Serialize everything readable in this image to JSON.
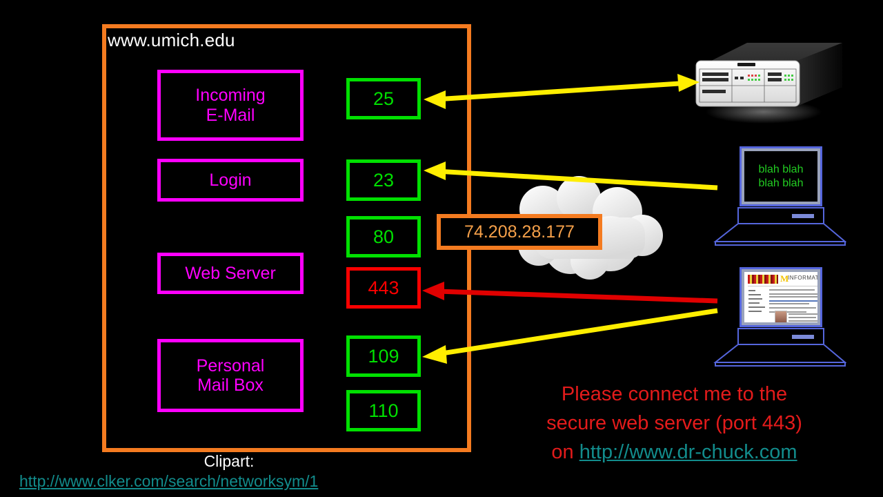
{
  "slide": {
    "background_color": "#000000",
    "domain_label": "www.umich.edu",
    "boundary_color": "#f47b20"
  },
  "services": [
    {
      "name": "incoming-email",
      "lines": [
        "Incoming",
        "E-Mail"
      ],
      "color": "#ff00ff"
    },
    {
      "name": "login",
      "lines": [
        "Login"
      ],
      "color": "#ff00ff"
    },
    {
      "name": "web-server",
      "lines": [
        "Web Server"
      ],
      "color": "#ff00ff"
    },
    {
      "name": "personal-mailbox",
      "lines": [
        "Personal",
        "Mail Box"
      ],
      "color": "#ff00ff"
    }
  ],
  "ports": [
    {
      "number": "25",
      "color": "#00e000",
      "state": "open"
    },
    {
      "number": "23",
      "color": "#00e000",
      "state": "open"
    },
    {
      "number": "80",
      "color": "#00e000",
      "state": "open"
    },
    {
      "number": "443",
      "color": "#fb0000",
      "state": "highlighted"
    },
    {
      "number": "109",
      "color": "#00e000",
      "state": "open"
    },
    {
      "number": "110",
      "color": "#00e000",
      "state": "open"
    }
  ],
  "ip_address": {
    "value": "74.208.28.177",
    "color": "#f5a04a",
    "border_color": "#f47b20"
  },
  "clients": {
    "terminal_laptop": {
      "screen_lines": [
        "blah blah",
        "blah blah"
      ],
      "text_color": "#22cc22"
    },
    "browser_laptop": {
      "page_logo_letter": "M",
      "page_logo_text": "INFORMATICS"
    }
  },
  "request_caption": {
    "line1": "Please connect me to the",
    "line2": "secure web server (port 443)",
    "line3_prefix": "on ",
    "line3_link": "http://www.dr-chuck.com",
    "text_color": "#e31b1b",
    "link_color": "#128c8c"
  },
  "credit": {
    "label": "Clipart:",
    "url": "http://www.clker.com/search/networksym/1",
    "link_color": "#128c8c"
  },
  "connections": [
    {
      "name": "switch-to-port-25",
      "color": "#ffee00",
      "heads": "both"
    },
    {
      "name": "cloud-to-port-23",
      "color": "#ffee00",
      "heads": "left"
    },
    {
      "name": "browser-to-port-443",
      "color": "#e00000",
      "heads": "left"
    },
    {
      "name": "browser-to-port-109",
      "color": "#ffee00",
      "heads": "left"
    }
  ]
}
